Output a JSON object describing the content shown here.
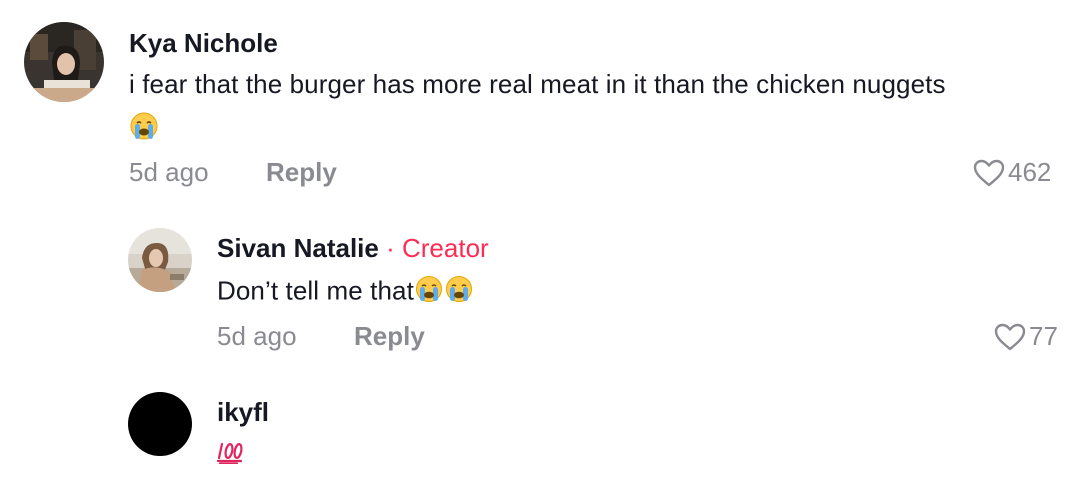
{
  "comments": [
    {
      "username": "Kya Nichole",
      "text": "i fear that the burger has more real meat in it than the chicken nuggets",
      "emoji": "😭",
      "time": "5d ago",
      "reply_label": "Reply",
      "likes": "462"
    },
    {
      "username": "Sivan Natalie",
      "separator": "·",
      "badge": "Creator",
      "text": "Don’t tell me that",
      "emoji": "😭😭",
      "time": "5d ago",
      "reply_label": "Reply",
      "likes": "77"
    },
    {
      "username": "ikyfl",
      "emoji": "💯"
    }
  ],
  "colors": {
    "creator": "#fe2c55",
    "secondary_text": "#8a8b91",
    "primary_text": "#161823"
  },
  "icons": [
    "heart-outline-icon",
    "crying-face-emoji",
    "hundred-points-emoji"
  ]
}
